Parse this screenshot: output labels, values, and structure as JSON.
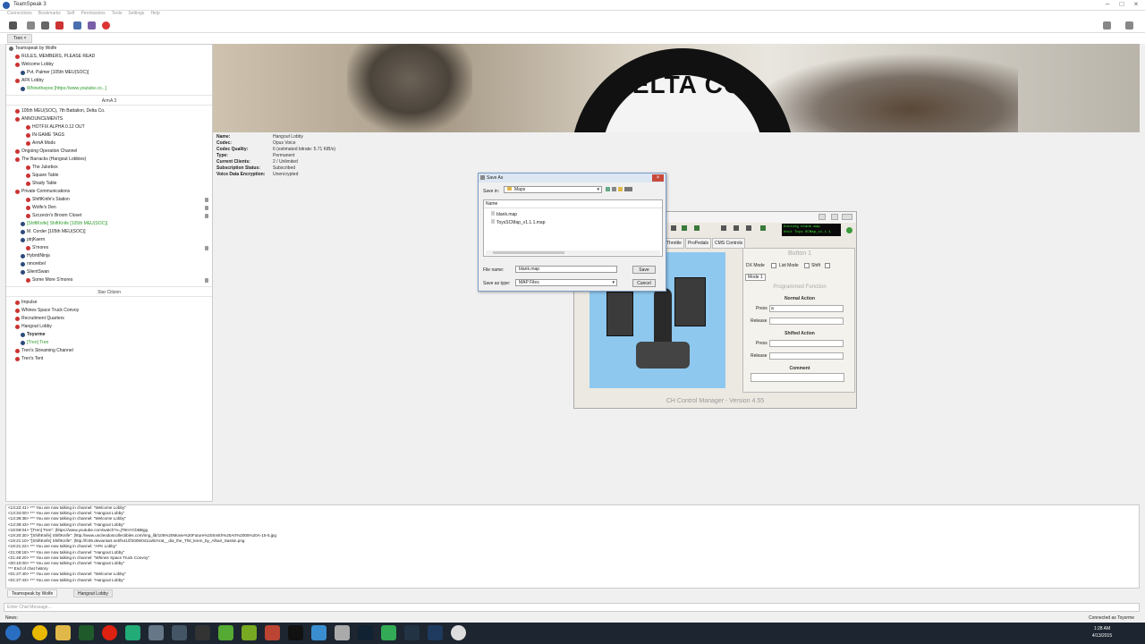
{
  "window": {
    "title": "TeamSpeak 3"
  },
  "menu": [
    "Connections",
    "Bookmarks",
    "Self",
    "Permissions",
    "Tools",
    "Settings",
    "Help"
  ],
  "server_tab": "Tren",
  "tree": [
    {
      "label": "Teamspeak by Wolfe",
      "type": "server"
    },
    {
      "label": "RULES, MEMBERS, PLEASE READ",
      "type": "channel"
    },
    {
      "label": "Welcome Lobby",
      "type": "channel"
    },
    {
      "label": "Pvt. Palmer [105th MEU(SOC)]",
      "type": "user"
    },
    {
      "label": "AFK Lobby",
      "type": "channel"
    },
    {
      "label": "Whinethepoo [https://www.youtube.co...]",
      "type": "user-green"
    },
    {
      "label": "ArmA 3",
      "type": "spacer"
    },
    {
      "label": "105th MEU(SOC), 7th Battalion, Delta Co.",
      "type": "channel"
    },
    {
      "label": "ANNOUNCEMENTS",
      "type": "channel"
    },
    {
      "label": "HOTFIX ALPHA 0.12 OUT",
      "type": "sub"
    },
    {
      "label": "IN-GAME TAGS",
      "type": "sub"
    },
    {
      "label": "ArmA Mods",
      "type": "sub"
    },
    {
      "label": "Ongoing Operation Channel",
      "type": "channel"
    },
    {
      "label": "The Barracks (Hangout Lobbies)",
      "type": "channel"
    },
    {
      "label": "The Jukebox",
      "type": "sub"
    },
    {
      "label": "Square Table",
      "type": "sub"
    },
    {
      "label": "Shady Table",
      "type": "sub"
    },
    {
      "label": "Private Communications",
      "type": "channel"
    },
    {
      "label": "ShiftKnife's Station",
      "type": "sub"
    },
    {
      "label": "Wolfe's Den",
      "type": "sub"
    },
    {
      "label": "Szczecin's Broom Closet",
      "type": "sub"
    },
    {
      "label": "[ShiftKnife] ShiftKnife [105th MEU(SOC)]",
      "type": "user-green"
    },
    {
      "label": "M. Corder [105th MEU(SOC)]",
      "type": "user"
    },
    {
      "label": "ptrjKaern",
      "type": "user"
    },
    {
      "label": "S'mores",
      "type": "sub"
    },
    {
      "label": "HybridNinja",
      "type": "user"
    },
    {
      "label": "nmorebel",
      "type": "user"
    },
    {
      "label": "SilentSwan",
      "type": "user"
    },
    {
      "label": "Some More S'mores",
      "type": "sub"
    },
    {
      "label": "Star Citizen",
      "type": "spacer"
    },
    {
      "label": "Impulse",
      "type": "channel"
    },
    {
      "label": "Whines Space Truck Convoy",
      "type": "channel"
    },
    {
      "label": "Recruitment Quarters",
      "type": "channel"
    },
    {
      "label": "Hangout Lobby",
      "type": "channel"
    },
    {
      "label": "Toysrme",
      "type": "user-bold"
    },
    {
      "label": "[Tren] Tren",
      "type": "user-green"
    },
    {
      "label": "Tren's Streaming Channel",
      "type": "channel"
    },
    {
      "label": "Tren's Tent",
      "type": "channel"
    }
  ],
  "channel_info": [
    {
      "k": "Name:",
      "v": "Hangout Lobby"
    },
    {
      "k": "Codec:",
      "v": "Opus Voice"
    },
    {
      "k": "Codec Quality:",
      "v": "6 (estimated bitrate: 5.71 KiB/s)"
    },
    {
      "k": "Type:",
      "v": "Permanent"
    },
    {
      "k": "Current Clients:",
      "v": "2 / Unlimited"
    },
    {
      "k": "Subscription Status:",
      "v": "Subscribed"
    },
    {
      "k": "Voice Data Encryption:",
      "v": "Unencrypted"
    }
  ],
  "banner": {
    "logo_text": "DELTA CO."
  },
  "save_dialog": {
    "title": "Save As",
    "save_in_label": "Save in:",
    "save_in_value": "Maps",
    "column_name": "Name",
    "files": [
      "blank.map",
      "ToysSCMap_v1.1.1.map"
    ],
    "file_name_label": "File name:",
    "file_name_value": "blank.map",
    "save_as_type_label": "Save as type:",
    "save_as_type_value": "MAP Files",
    "save_button": "Save",
    "cancel_button": "Cancel"
  },
  "ch_manager": {
    "lcd_line1": "Editing blank.map",
    "lcd_line2": "Unit Toys SCMap_v1.1.1",
    "tabs": [
      "Throttle",
      "ProPedals",
      "CMS Controls"
    ],
    "button_title": "Button 1",
    "dx_mode": "DX Mode",
    "list_mode": "List Mode",
    "shift": "Shift",
    "mode": "Mode 1",
    "programmed_function": "Programmed Function",
    "normal_action": "Normal Action",
    "shifted_action": "Shifted Action",
    "comment": "Comment",
    "press": "Press",
    "release": "Release",
    "press_value": "a",
    "footer": "CH Control Manager - Version 4.55"
  },
  "chat_log": [
    "<13:22:41> *** You are now talking in channel: \"Welcome Lobby\"",
    "<13:34:00> *** You are now talking in channel: \"Hangout Lobby\"",
    "<13:39:38> *** You are now talking in channel: \"Welcome Lobby\"",
    "<13:39:43> *** You are now talking in channel: \"Hangout Lobby\"",
    "<18:59:04> \"[Tren] Tren\": |https://www.youtube.com/watch?v=jT9mYCbBBgg",
    "<19:20:30> \"[ShiftKnife] ShiftKnife\": |http://www.uncleodoscollectibles.com/img_lib/105%20Movie%20Future%20Smith%20Art%2005%20A-15-5.jpg",
    "<19:21:10> \"[ShiftKnife] ShiftKnife\": |http://fc09.deviantart.net/fs41/f/2009/041/a/8/Arat__dia_the_Thit_krem_by_Alhair_Sassin.png",
    "<19:21:22> *** You are now talking in channel: \"AFK Lobby\"",
    "<21:08:18> *** You are now talking in channel: \"Hangout Lobby\"",
    "<21:46:20> *** You are now talking in channel: \"Whines Space Truck Convoy\"",
    "<00:10:00> *** You are now talking in channel: \"Hangout Lobby\"",
    "*** End of chat history",
    "<01:27:40> *** You are now talking in channel: \"Welcome Lobby\"",
    "<01:27:43> *** You are now talking in channel: \"Hangout Lobby\""
  ],
  "chat_tabs": [
    "Teamspeak by Wolfe",
    "Hangout Lobby"
  ],
  "chat_input_placeholder": "Enter Chat Message...",
  "status": {
    "left": "News:",
    "right": "Connected as Toysrme"
  },
  "clock": {
    "time": "1:28 AM",
    "date": "4/13/2015"
  }
}
